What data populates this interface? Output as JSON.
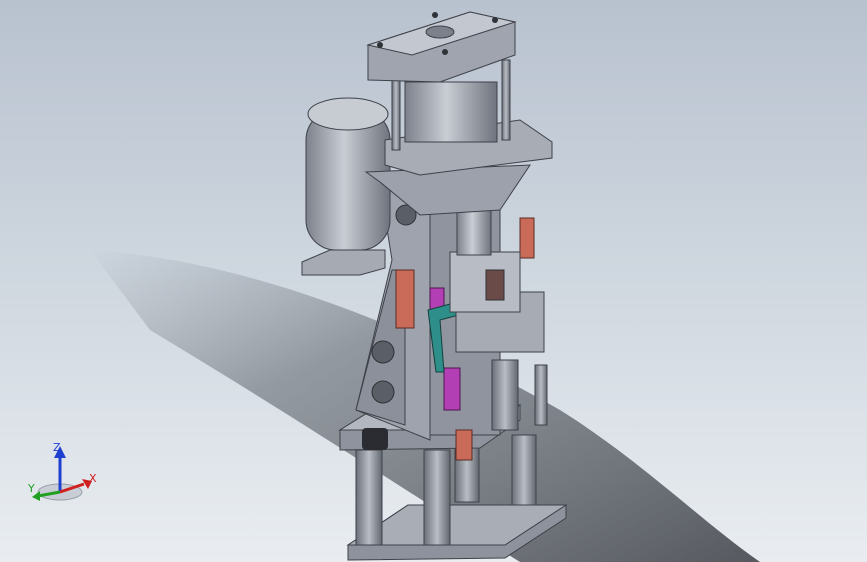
{
  "viewport": {
    "background_top": "#b8c2cf",
    "background_bottom": "#e9edf1"
  },
  "model": {
    "body_color": "#9a9fa9",
    "body_light": "#c4c8d0",
    "body_dark": "#6d727c",
    "accent_magenta": "#b23fb3",
    "accent_teal": "#2e8f8a",
    "accent_copper": "#c96b58"
  },
  "triad": {
    "z_label": "Z",
    "y_label": "Y",
    "x_label": "X",
    "z_color": "#1f3fd0",
    "y_color": "#22a022",
    "x_color": "#d01f1f"
  }
}
